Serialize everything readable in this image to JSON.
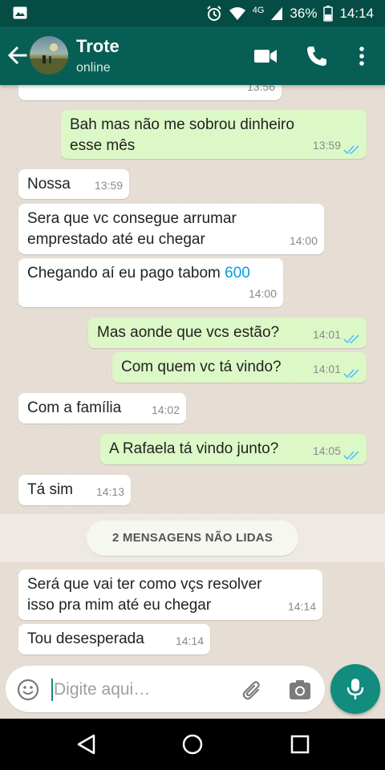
{
  "status_bar": {
    "network": "4G",
    "battery": "36%",
    "time": "14:14"
  },
  "header": {
    "title": "Trote",
    "subtitle": "online",
    "icons": [
      "back-arrow-icon",
      "video-call-icon",
      "phone-icon",
      "more-vert-icon"
    ]
  },
  "messages": [
    {
      "direction": "in",
      "text": "",
      "time": "13:56"
    },
    {
      "direction": "out",
      "lines": [
        "Bah mas não me sobrou dinheiro",
        "esse mês"
      ],
      "time": "13:59",
      "read": true
    },
    {
      "direction": "in",
      "text": "Nossa",
      "time": "13:59"
    },
    {
      "direction": "in",
      "lines": [
        "Sera que vc consegue arrumar",
        "emprestado até eu chegar"
      ],
      "time": "14:00"
    },
    {
      "direction": "in",
      "text": "Chegando aí eu pago tabom",
      "link": "600",
      "time": "14:00"
    },
    {
      "direction": "out",
      "text": "Mas aonde que vcs estão?",
      "time": "14:01",
      "read": true
    },
    {
      "direction": "out",
      "text": "Com quem vc tá vindo?",
      "time": "14:01",
      "read": true
    },
    {
      "direction": "in",
      "text": "Com a família",
      "time": "14:02"
    },
    {
      "direction": "out",
      "text": "A Rafaela tá vindo junto?",
      "time": "14:05",
      "read": true
    },
    {
      "direction": "in",
      "text": "Tá sim",
      "time": "14:13"
    },
    {
      "direction": "in",
      "lines": [
        "Será que vai ter como vçs resolver",
        "isso pra mim até eu chegar"
      ],
      "time": "14:14"
    },
    {
      "direction": "in",
      "text": "Tou desesperada",
      "time": "14:14"
    }
  ],
  "unread_banner": "2 MENSAGENS NÃO LIDAS",
  "composer": {
    "placeholder": "Digite aqui…"
  },
  "colors": {
    "status_bar": "#054d44",
    "app_bar": "#075e54",
    "outgoing_bubble": "#dcf8c6",
    "incoming_bubble": "#ffffff",
    "accent": "#128c7e",
    "read_ticks": "#4fc3f7"
  }
}
